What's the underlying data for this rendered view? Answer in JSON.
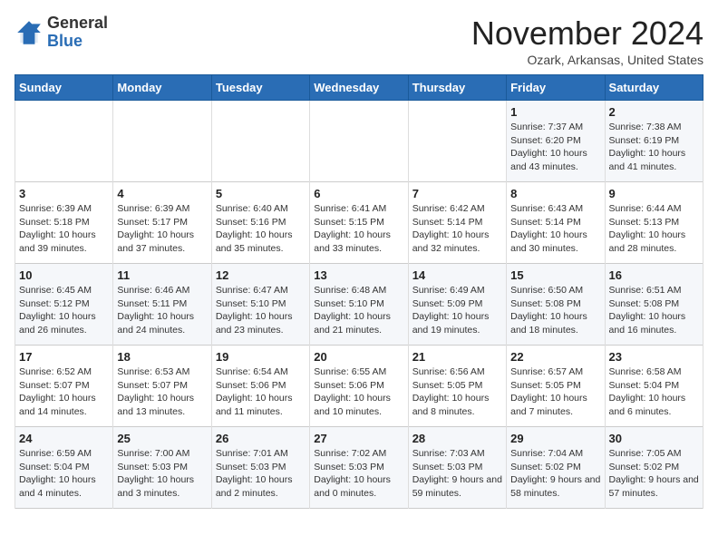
{
  "app": {
    "name": "GeneralBlue",
    "logo_text_general": "General",
    "logo_text_blue": "Blue"
  },
  "header": {
    "month_title": "November 2024",
    "subtitle": "Ozark, Arkansas, United States"
  },
  "weekdays": [
    "Sunday",
    "Monday",
    "Tuesday",
    "Wednesday",
    "Thursday",
    "Friday",
    "Saturday"
  ],
  "weeks": [
    [
      {
        "day": "",
        "info": ""
      },
      {
        "day": "",
        "info": ""
      },
      {
        "day": "",
        "info": ""
      },
      {
        "day": "",
        "info": ""
      },
      {
        "day": "",
        "info": ""
      },
      {
        "day": "1",
        "info": "Sunrise: 7:37 AM\nSunset: 6:20 PM\nDaylight: 10 hours and 43 minutes."
      },
      {
        "day": "2",
        "info": "Sunrise: 7:38 AM\nSunset: 6:19 PM\nDaylight: 10 hours and 41 minutes."
      }
    ],
    [
      {
        "day": "3",
        "info": "Sunrise: 6:39 AM\nSunset: 5:18 PM\nDaylight: 10 hours and 39 minutes."
      },
      {
        "day": "4",
        "info": "Sunrise: 6:39 AM\nSunset: 5:17 PM\nDaylight: 10 hours and 37 minutes."
      },
      {
        "day": "5",
        "info": "Sunrise: 6:40 AM\nSunset: 5:16 PM\nDaylight: 10 hours and 35 minutes."
      },
      {
        "day": "6",
        "info": "Sunrise: 6:41 AM\nSunset: 5:15 PM\nDaylight: 10 hours and 33 minutes."
      },
      {
        "day": "7",
        "info": "Sunrise: 6:42 AM\nSunset: 5:14 PM\nDaylight: 10 hours and 32 minutes."
      },
      {
        "day": "8",
        "info": "Sunrise: 6:43 AM\nSunset: 5:14 PM\nDaylight: 10 hours and 30 minutes."
      },
      {
        "day": "9",
        "info": "Sunrise: 6:44 AM\nSunset: 5:13 PM\nDaylight: 10 hours and 28 minutes."
      }
    ],
    [
      {
        "day": "10",
        "info": "Sunrise: 6:45 AM\nSunset: 5:12 PM\nDaylight: 10 hours and 26 minutes."
      },
      {
        "day": "11",
        "info": "Sunrise: 6:46 AM\nSunset: 5:11 PM\nDaylight: 10 hours and 24 minutes."
      },
      {
        "day": "12",
        "info": "Sunrise: 6:47 AM\nSunset: 5:10 PM\nDaylight: 10 hours and 23 minutes."
      },
      {
        "day": "13",
        "info": "Sunrise: 6:48 AM\nSunset: 5:10 PM\nDaylight: 10 hours and 21 minutes."
      },
      {
        "day": "14",
        "info": "Sunrise: 6:49 AM\nSunset: 5:09 PM\nDaylight: 10 hours and 19 minutes."
      },
      {
        "day": "15",
        "info": "Sunrise: 6:50 AM\nSunset: 5:08 PM\nDaylight: 10 hours and 18 minutes."
      },
      {
        "day": "16",
        "info": "Sunrise: 6:51 AM\nSunset: 5:08 PM\nDaylight: 10 hours and 16 minutes."
      }
    ],
    [
      {
        "day": "17",
        "info": "Sunrise: 6:52 AM\nSunset: 5:07 PM\nDaylight: 10 hours and 14 minutes."
      },
      {
        "day": "18",
        "info": "Sunrise: 6:53 AM\nSunset: 5:07 PM\nDaylight: 10 hours and 13 minutes."
      },
      {
        "day": "19",
        "info": "Sunrise: 6:54 AM\nSunset: 5:06 PM\nDaylight: 10 hours and 11 minutes."
      },
      {
        "day": "20",
        "info": "Sunrise: 6:55 AM\nSunset: 5:06 PM\nDaylight: 10 hours and 10 minutes."
      },
      {
        "day": "21",
        "info": "Sunrise: 6:56 AM\nSunset: 5:05 PM\nDaylight: 10 hours and 8 minutes."
      },
      {
        "day": "22",
        "info": "Sunrise: 6:57 AM\nSunset: 5:05 PM\nDaylight: 10 hours and 7 minutes."
      },
      {
        "day": "23",
        "info": "Sunrise: 6:58 AM\nSunset: 5:04 PM\nDaylight: 10 hours and 6 minutes."
      }
    ],
    [
      {
        "day": "24",
        "info": "Sunrise: 6:59 AM\nSunset: 5:04 PM\nDaylight: 10 hours and 4 minutes."
      },
      {
        "day": "25",
        "info": "Sunrise: 7:00 AM\nSunset: 5:03 PM\nDaylight: 10 hours and 3 minutes."
      },
      {
        "day": "26",
        "info": "Sunrise: 7:01 AM\nSunset: 5:03 PM\nDaylight: 10 hours and 2 minutes."
      },
      {
        "day": "27",
        "info": "Sunrise: 7:02 AM\nSunset: 5:03 PM\nDaylight: 10 hours and 0 minutes."
      },
      {
        "day": "28",
        "info": "Sunrise: 7:03 AM\nSunset: 5:03 PM\nDaylight: 9 hours and 59 minutes."
      },
      {
        "day": "29",
        "info": "Sunrise: 7:04 AM\nSunset: 5:02 PM\nDaylight: 9 hours and 58 minutes."
      },
      {
        "day": "30",
        "info": "Sunrise: 7:05 AM\nSunset: 5:02 PM\nDaylight: 9 hours and 57 minutes."
      }
    ]
  ]
}
